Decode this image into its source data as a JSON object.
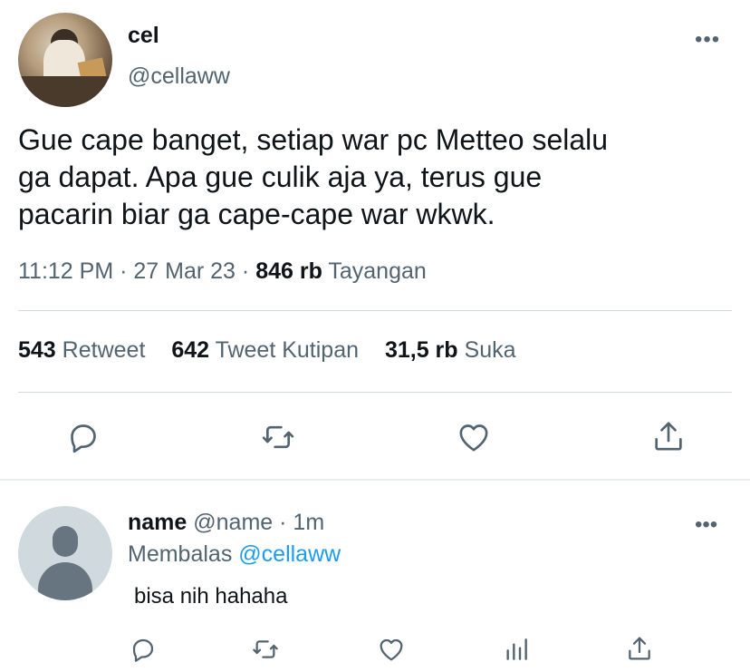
{
  "tweet": {
    "author": {
      "name": "cel",
      "handle": "@cellaww"
    },
    "more_label": "•••",
    "text": "Gue cape banget, setiap war pc Metteo selalu\nga dapat. Apa gue culik aja ya, terus gue\npacarin biar ga cape-cape war wkwk.",
    "time": "11:12 PM",
    "sep": "·",
    "date": "27 Mar 23",
    "views_count": "846 rb",
    "views_label": "Tayangan",
    "stats": {
      "retweets": {
        "count": "543",
        "label": "Retweet"
      },
      "quotes": {
        "count": "642",
        "label": "Tweet Kutipan"
      },
      "likes": {
        "count": "31,5 rb",
        "label": "Suka"
      }
    },
    "actions": [
      "reply-icon",
      "retweet-icon",
      "like-icon",
      "share-icon"
    ]
  },
  "reply": {
    "name": "name",
    "handle": "@name",
    "sep": "·",
    "time": "1m",
    "replying_prefix": "Membalas",
    "replying_to": "@cellaww",
    "text": "bisa nih hahaha",
    "more_label": "•••",
    "actions": [
      "reply-icon",
      "retweet-icon",
      "like-icon",
      "analytics-icon",
      "share-icon"
    ]
  },
  "colors": {
    "text": "#0f1419",
    "muted": "#536471",
    "link": "#1d9bf0",
    "divider": "#cfd9de"
  }
}
